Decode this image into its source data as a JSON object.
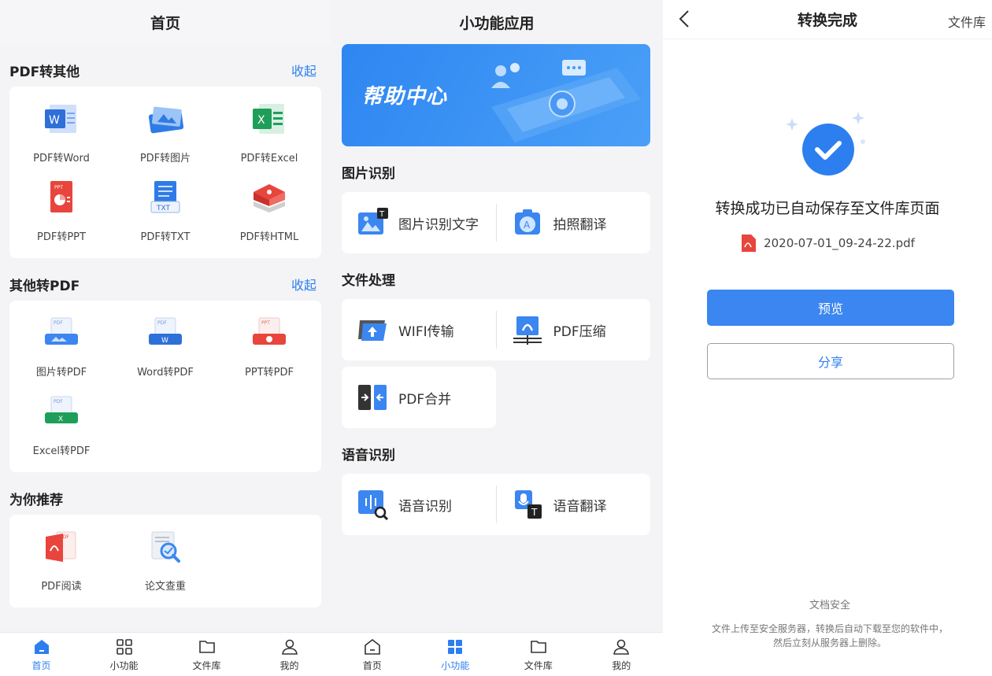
{
  "home": {
    "title": "首页",
    "sections": [
      {
        "title": "PDF转其他",
        "link": "收起",
        "items": [
          {
            "label": "PDF转Word",
            "icon": "word-doc-icon"
          },
          {
            "label": "PDF转图片",
            "icon": "image-stack-icon"
          },
          {
            "label": "PDF转Excel",
            "icon": "excel-doc-icon"
          },
          {
            "label": "PDF转PPT",
            "icon": "ppt-doc-icon"
          },
          {
            "label": "PDF转TXT",
            "icon": "txt-doc-icon"
          },
          {
            "label": "PDF转HTML",
            "icon": "html-doc-icon"
          }
        ]
      },
      {
        "title": "其他转PDF",
        "link": "收起",
        "items": [
          {
            "label": "图片转PDF",
            "icon": "image-to-pdf-icon"
          },
          {
            "label": "Word转PDF",
            "icon": "word-to-pdf-icon"
          },
          {
            "label": "PPT转PDF",
            "icon": "ppt-to-pdf-icon"
          },
          {
            "label": "Excel转PDF",
            "icon": "excel-to-pdf-icon"
          }
        ]
      },
      {
        "title": "为你推荐",
        "link": "",
        "items": [
          {
            "label": "PDF阅读",
            "icon": "pdf-reader-icon"
          },
          {
            "label": "论文查重",
            "icon": "paper-check-icon"
          }
        ]
      }
    ]
  },
  "tools": {
    "title": "小功能应用",
    "banner": "帮助中心",
    "sections": [
      {
        "title": "图片识别",
        "items": [
          "图片识别文字",
          "拍照翻译"
        ]
      },
      {
        "title": "文件处理",
        "items": [
          "WIFI传输",
          "PDF压缩",
          "PDF合并"
        ]
      },
      {
        "title": "语音识别",
        "items": [
          "语音识别",
          "语音翻译"
        ]
      }
    ]
  },
  "result": {
    "title": "转换完成",
    "right_link": "文件库",
    "message": "转换成功已自动保存至文件库页面",
    "filename": "2020-07-01_09-24-22.pdf",
    "preview": "预览",
    "share": "分享",
    "security_title": "文档安全",
    "security_text": "文件上传至安全服务器，转换后自动下载至您的软件中，然后立刻从服务器上删除。"
  },
  "nav": [
    "首页",
    "小功能",
    "文件库",
    "我的"
  ],
  "colors": {
    "accent": "#2d7ff0",
    "pdf_red": "#e8453c",
    "excel_green": "#1f9e5a"
  }
}
